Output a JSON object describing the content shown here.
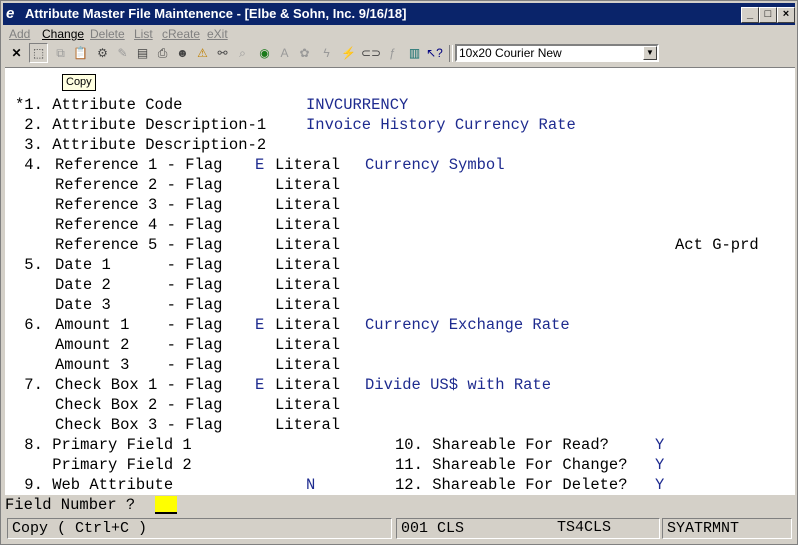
{
  "window": {
    "title": "Attribute Master File Maintenence - [Elbe & Sohn, Inc. 9/16/18]",
    "app_icon": "e"
  },
  "title_buttons": {
    "minimize": "_",
    "maximize": "□",
    "close": "×"
  },
  "menu": [
    "Add",
    "Change",
    "Delete",
    "List",
    "cReate",
    "eXit"
  ],
  "toolbar": {
    "font_select": "10x20 Courier New",
    "tooltip": "Copy"
  },
  "screen": {
    "lines": [
      {
        "text": "*1. Attribute Code",
        "value": "INVCURRENCY"
      },
      {
        "text": " 2. Attribute Description-1",
        "value": "Invoice History Currency Rate"
      },
      {
        "text": " 3. Attribute Description-2",
        "value": ""
      }
    ],
    "refs": [
      {
        "num": " 4.",
        "label": "Reference 1 - Flag",
        "flag": "E",
        "lit": "Literal",
        "value": "Currency Symbol"
      },
      {
        "num": "",
        "label": "Reference 2 - Flag",
        "flag": "",
        "lit": "Literal",
        "value": ""
      },
      {
        "num": "",
        "label": "Reference 3 - Flag",
        "flag": "",
        "lit": "Literal",
        "value": ""
      },
      {
        "num": "",
        "label": "Reference 4 - Flag",
        "flag": "",
        "lit": "Literal",
        "value": ""
      },
      {
        "num": "",
        "label": "Reference 5 - Flag",
        "flag": "",
        "lit": "Literal",
        "value": ""
      },
      {
        "num": " 5.",
        "label": "Date 1      - Flag",
        "flag": "",
        "lit": "Literal",
        "value": ""
      },
      {
        "num": "",
        "label": "Date 2      - Flag",
        "flag": "",
        "lit": "Literal",
        "value": ""
      },
      {
        "num": "",
        "label": "Date 3      - Flag",
        "flag": "",
        "lit": "Literal",
        "value": ""
      },
      {
        "num": " 6.",
        "label": "Amount 1    - Flag",
        "flag": "E",
        "lit": "Literal",
        "value": "Currency Exchange Rate"
      },
      {
        "num": "",
        "label": "Amount 2    - Flag",
        "flag": "",
        "lit": "Literal",
        "value": ""
      },
      {
        "num": "",
        "label": "Amount 3    - Flag",
        "flag": "",
        "lit": "Literal",
        "value": ""
      },
      {
        "num": " 7.",
        "label": "Check Box 1 - Flag",
        "flag": "E",
        "lit": "Literal",
        "value": "Divide US$ with Rate"
      },
      {
        "num": "",
        "label": "Check Box 2 - Flag",
        "flag": "",
        "lit": "Literal",
        "value": ""
      },
      {
        "num": "",
        "label": "Check Box 3 - Flag",
        "flag": "",
        "lit": "Literal",
        "value": ""
      }
    ],
    "act_label": "Act G-prd",
    "primary1": " 8. Primary Field 1",
    "primary2": "    Primary Field 2",
    "web": " 9. Web Attribute",
    "web_value": "N",
    "share": [
      {
        "label": "10. Shareable For Read?",
        "value": "Y"
      },
      {
        "label": "11. Shareable For Change?",
        "value": "Y"
      },
      {
        "label": "12. Shareable For Delete?",
        "value": "Y"
      }
    ]
  },
  "command": {
    "label": "Field Number ?",
    "value": ""
  },
  "status": {
    "msg": "Copy ( Ctrl+C )",
    "code": "001 CLS",
    "sys": "TS4CLS",
    "prog": "SYATRMNT"
  }
}
